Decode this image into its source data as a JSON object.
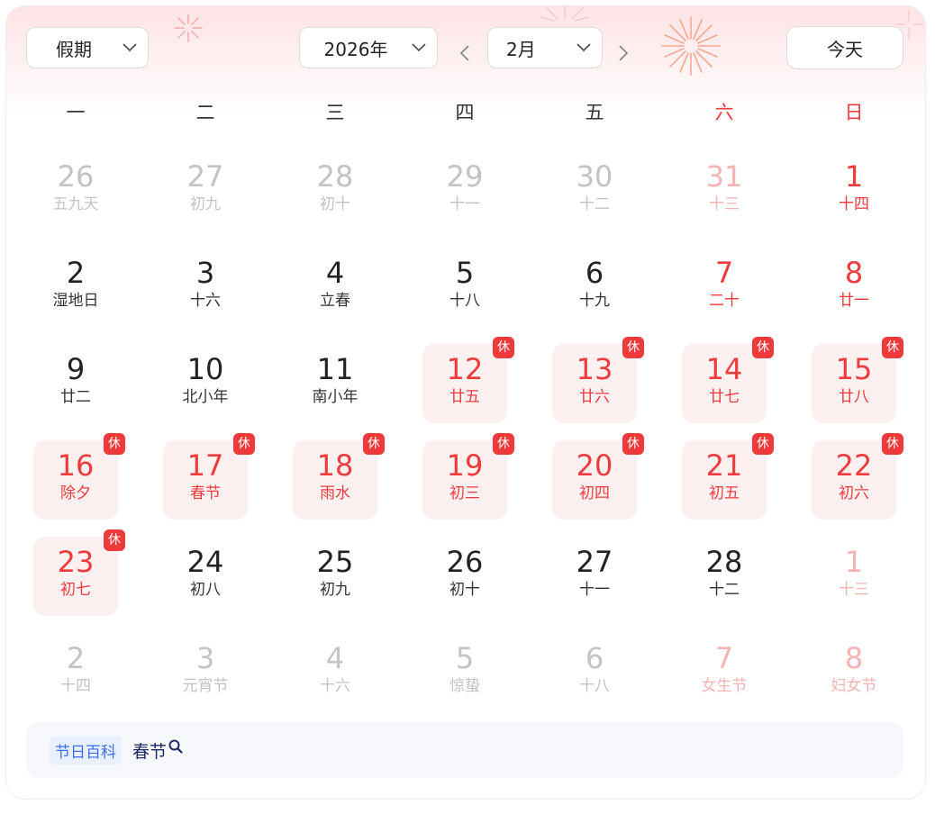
{
  "header": {
    "holiday_select": "假期",
    "year_select": "2026年",
    "month_select": "2月",
    "today_button": "今天"
  },
  "weekdays": [
    "一",
    "二",
    "三",
    "四",
    "五",
    "六",
    "日"
  ],
  "rest_badge": "休",
  "days": [
    {
      "d": "26",
      "l": "五九天",
      "s": "dim"
    },
    {
      "d": "27",
      "l": "初九",
      "s": "dim"
    },
    {
      "d": "28",
      "l": "初十",
      "s": "dim"
    },
    {
      "d": "29",
      "l": "十一",
      "s": "dim"
    },
    {
      "d": "30",
      "l": "十二",
      "s": "dim"
    },
    {
      "d": "31",
      "l": "十三",
      "s": "dimred"
    },
    {
      "d": "1",
      "l": "十四",
      "s": "weekend"
    },
    {
      "d": "2",
      "l": "湿地日",
      "s": "normal"
    },
    {
      "d": "3",
      "l": "十六",
      "s": "normal"
    },
    {
      "d": "4",
      "l": "立春",
      "s": "normal"
    },
    {
      "d": "5",
      "l": "十八",
      "s": "normal"
    },
    {
      "d": "6",
      "l": "十九",
      "s": "normal"
    },
    {
      "d": "7",
      "l": "二十",
      "s": "weekend"
    },
    {
      "d": "8",
      "l": "廿一",
      "s": "weekend"
    },
    {
      "d": "9",
      "l": "廿二",
      "s": "normal"
    },
    {
      "d": "10",
      "l": "北小年",
      "s": "normal"
    },
    {
      "d": "11",
      "l": "南小年",
      "s": "normal"
    },
    {
      "d": "12",
      "l": "廿五",
      "s": "rest"
    },
    {
      "d": "13",
      "l": "廿六",
      "s": "rest"
    },
    {
      "d": "14",
      "l": "廿七",
      "s": "rest"
    },
    {
      "d": "15",
      "l": "廿八",
      "s": "rest"
    },
    {
      "d": "16",
      "l": "除夕",
      "s": "rest"
    },
    {
      "d": "17",
      "l": "春节",
      "s": "rest"
    },
    {
      "d": "18",
      "l": "雨水",
      "s": "rest"
    },
    {
      "d": "19",
      "l": "初三",
      "s": "rest"
    },
    {
      "d": "20",
      "l": "初四",
      "s": "rest"
    },
    {
      "d": "21",
      "l": "初五",
      "s": "rest"
    },
    {
      "d": "22",
      "l": "初六",
      "s": "rest"
    },
    {
      "d": "23",
      "l": "初七",
      "s": "rest"
    },
    {
      "d": "24",
      "l": "初八",
      "s": "normal"
    },
    {
      "d": "25",
      "l": "初九",
      "s": "normal"
    },
    {
      "d": "26",
      "l": "初十",
      "s": "normal"
    },
    {
      "d": "27",
      "l": "十一",
      "s": "normal"
    },
    {
      "d": "28",
      "l": "十二",
      "s": "normal"
    },
    {
      "d": "1",
      "l": "十三",
      "s": "dimred"
    },
    {
      "d": "2",
      "l": "十四",
      "s": "dim"
    },
    {
      "d": "3",
      "l": "元宵节",
      "s": "dim"
    },
    {
      "d": "4",
      "l": "十六",
      "s": "dim"
    },
    {
      "d": "5",
      "l": "惊蛰",
      "s": "dim"
    },
    {
      "d": "6",
      "l": "十八",
      "s": "dim"
    },
    {
      "d": "7",
      "l": "女生节",
      "s": "dimred"
    },
    {
      "d": "8",
      "l": "妇女节",
      "s": "dimred"
    }
  ],
  "footer": {
    "tag": "节日百科",
    "term": "春节",
    "icon": "search-icon"
  },
  "colors": {
    "accent_red": "#ee3a3a",
    "rest_bg": "#fdf0f0",
    "tag_blue": "#3d6df2"
  }
}
